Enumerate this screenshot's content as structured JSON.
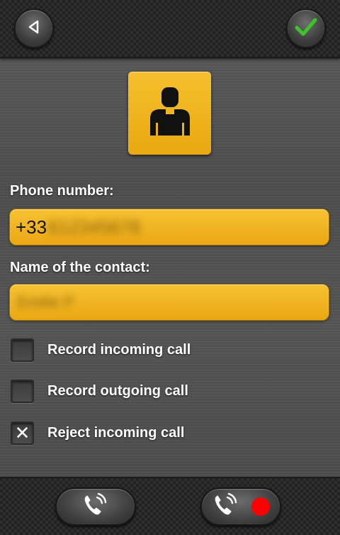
{
  "header": {
    "back_icon": "back-triangle-icon",
    "confirm_icon": "checkmark-icon"
  },
  "avatar": {
    "icon": "person-silhouette-icon"
  },
  "phone": {
    "label": "Phone number:",
    "value_prefix": "+33",
    "value_obscured": "612345678"
  },
  "contact": {
    "label": "Name of the contact:",
    "value_obscured": "Emilie P"
  },
  "options": [
    {
      "label": "Record incoming call",
      "checked": false,
      "mark": ""
    },
    {
      "label": "Record outgoing call",
      "checked": false,
      "mark": ""
    },
    {
      "label": "Reject incoming call",
      "checked": true,
      "mark": "✕"
    }
  ],
  "footer": {
    "call_icon": "phone-call-icon",
    "record_icon": "record-dot-icon"
  },
  "colors": {
    "accent_yellow": "#f2b51f",
    "confirm_green": "#3ec32a",
    "record_red": "#ff0000"
  }
}
